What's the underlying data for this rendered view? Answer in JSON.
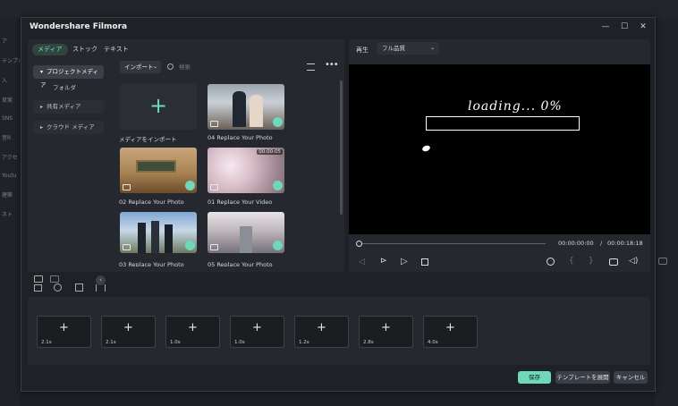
{
  "background": {
    "left_labels": [
      "ア",
      "テンプレー",
      "入 ",
      "草案",
      "SNS",
      "音R",
      "アクセ",
      "Youtu",
      "建築",
      "ネト"
    ]
  },
  "window": {
    "title": "Wondershare Filmora",
    "controls": {
      "minimize": "—",
      "maximize": "☐",
      "close": "✕"
    }
  },
  "media": {
    "tabs": [
      {
        "label": "メディア",
        "active": true
      },
      {
        "label": "ストック",
        "active": false
      },
      {
        "label": "テキスト",
        "active": false
      }
    ],
    "sidebar": [
      {
        "label": "プロジェクトメディア",
        "arrow": "▾"
      },
      {
        "label": "フォルダ",
        "arrow": ""
      },
      {
        "label": "共有メディア",
        "arrow": "▸"
      },
      {
        "label": "クラウド メディア",
        "arrow": "▸"
      }
    ],
    "import_dropdown": "インポート",
    "search_placeholder": "検索",
    "items": [
      {
        "label": "メディアをインポート",
        "type": "import"
      },
      {
        "label": "04 Replace Your Photo",
        "type": "photo",
        "checked": true
      },
      {
        "label": "02 Replace Your Photo",
        "type": "photo",
        "checked": true
      },
      {
        "label": "01 Replace Your Video",
        "type": "video",
        "checked": true,
        "duration": "00:00:05"
      },
      {
        "label": "03 Replace Your Photo",
        "type": "photo",
        "checked": true
      },
      {
        "label": "05 Replace Your Photo",
        "type": "photo",
        "checked": true
      }
    ]
  },
  "preview": {
    "label": "再生",
    "quality": "フル品質",
    "loading_text": "loading... 0%",
    "progress": 0,
    "current_time": "00:00:00:00",
    "separator": "/",
    "total_time": "00:00:18:18"
  },
  "slots": [
    {
      "duration": "2.1s"
    },
    {
      "duration": "2.1s"
    },
    {
      "duration": "1.0s"
    },
    {
      "duration": "1.0s"
    },
    {
      "duration": "1.2s"
    },
    {
      "duration": "2.8s"
    },
    {
      "duration": "4.0s"
    }
  ],
  "buttons": {
    "save": "保存",
    "expand_template": "テンプレートを展開",
    "cancel": "キャンセル"
  },
  "colors": {
    "accent": "#6fd8b8",
    "panel": "#25282e",
    "dialog": "#1e2126"
  }
}
